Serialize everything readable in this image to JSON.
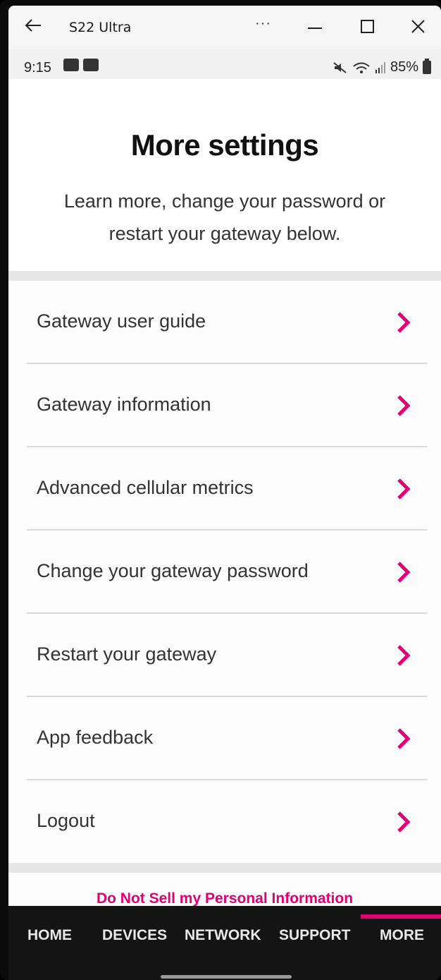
{
  "window": {
    "title": "S22 Ultra",
    "more_label": "···"
  },
  "status_bar": {
    "time": "9:15",
    "battery": "85%"
  },
  "page": {
    "title": "More settings",
    "subtitle": "Learn more, change your password or restart your gateway below."
  },
  "menu": {
    "items": [
      {
        "label": "Gateway user guide"
      },
      {
        "label": "Gateway information"
      },
      {
        "label": "Advanced cellular metrics"
      },
      {
        "label": "Change your gateway password"
      },
      {
        "label": "Restart your gateway"
      },
      {
        "label": "App feedback"
      },
      {
        "label": "Logout"
      }
    ]
  },
  "footer_link": "Do Not Sell my Personal Information",
  "nav": {
    "items": [
      {
        "label": "HOME"
      },
      {
        "label": "DEVICES"
      },
      {
        "label": "NETWORK"
      },
      {
        "label": "SUPPORT"
      },
      {
        "label": "MORE"
      }
    ],
    "active": "MORE"
  },
  "colors": {
    "accent": "#e20074",
    "nav_bg": "#141414"
  }
}
